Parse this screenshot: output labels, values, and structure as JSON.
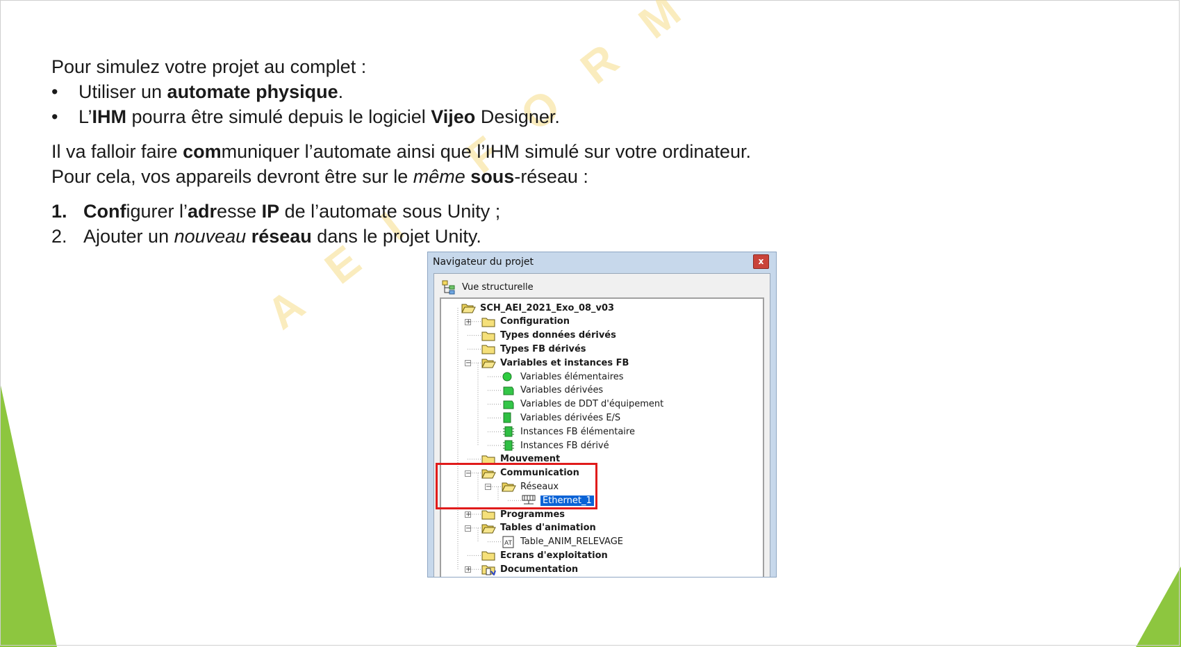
{
  "slide": {
    "intro": "Pour simulez votre projet au complet :",
    "bullets": [
      {
        "pre": "Utiliser un ",
        "bold": "automate physique",
        "post": "."
      },
      {
        "pre": "L’",
        "bold": "IHM",
        "mid": " pourra être simulé depuis le logiciel ",
        "bold2": "Vijeo",
        "post": " Designer."
      }
    ],
    "para1_a": "Il va falloir faire ",
    "para1_bold": "com",
    "para1_b": "muniquer l’automate ainsi que l’IHM simulé sur votre ordinateur.",
    "para2_a": "Pour cela, vos appareils devront être sur le ",
    "para2_italic": "même",
    "para2_bold": "sous",
    "para2_b": "-réseau :",
    "steps": [
      {
        "num": "1.",
        "b1": "Conf",
        "t1": "igurer l’",
        "b2": "adr",
        "t2": "esse ",
        "b3": "IP",
        "t3": " de l’automate sous Unity ;"
      },
      {
        "num": "2.",
        "t1": "Ajouter un ",
        "i1": "nouveau",
        "b1": "réseau",
        "t2": " dans le projet Unity."
      }
    ],
    "watermark": "AEI FORMA OUEST"
  },
  "navigator": {
    "title": "Navigateur du projet",
    "close": "x",
    "tab_label": "Vue structurelle",
    "tree": [
      {
        "label": "SCH_AEI_2021_Exo_08_v03",
        "bold": true,
        "icon": "folder-open-icon"
      },
      {
        "label": "Configuration",
        "bold": true,
        "icon": "folder-icon",
        "expander": "+"
      },
      {
        "label": "Types données dérivés",
        "bold": true,
        "icon": "folder-icon"
      },
      {
        "label": "Types FB dérivés",
        "bold": true,
        "icon": "folder-icon"
      },
      {
        "label": "Variables et instances FB",
        "bold": true,
        "icon": "folder-open-icon",
        "expander": "−"
      },
      {
        "label": "Variables élémentaires",
        "bold": false,
        "icon": "green-dot-icon"
      },
      {
        "label": "Variables dérivées",
        "bold": false,
        "icon": "green-block-icon"
      },
      {
        "label": "Variables de DDT d'équipement",
        "bold": false,
        "icon": "green-block-icon"
      },
      {
        "label": "Variables dérivées E/S",
        "bold": false,
        "icon": "green-bar-icon"
      },
      {
        "label": "Instances FB élémentaire",
        "bold": false,
        "icon": "green-chip-icon"
      },
      {
        "label": "Instances FB dérivé",
        "bold": false,
        "icon": "green-chip-icon"
      },
      {
        "label": "Mouvement",
        "bold": true,
        "icon": "folder-icon"
      },
      {
        "label": "Communication",
        "bold": true,
        "icon": "folder-open-icon",
        "expander": "−"
      },
      {
        "label": "Réseaux",
        "bold": false,
        "icon": "folder-open-icon",
        "expander": "−"
      },
      {
        "label": "Ethernet_1",
        "bold": false,
        "icon": "network-icon",
        "selected": true
      },
      {
        "label": "Programmes",
        "bold": true,
        "icon": "folder-icon",
        "expander": "+"
      },
      {
        "label": "Tables d'animation",
        "bold": true,
        "icon": "folder-open-icon",
        "expander": "−"
      },
      {
        "label": "Table_ANIM_RELEVAGE",
        "bold": false,
        "icon": "animation-table-icon"
      },
      {
        "label": "Ecrans d'exploitation",
        "bold": true,
        "icon": "folder-icon"
      },
      {
        "label": "Documentation",
        "bold": true,
        "icon": "documentation-icon",
        "expander": "+"
      }
    ],
    "colors": {
      "selection": "#0a63d6",
      "highlight_box": "#e01b1b",
      "accent_green": "#8dc63f"
    }
  }
}
